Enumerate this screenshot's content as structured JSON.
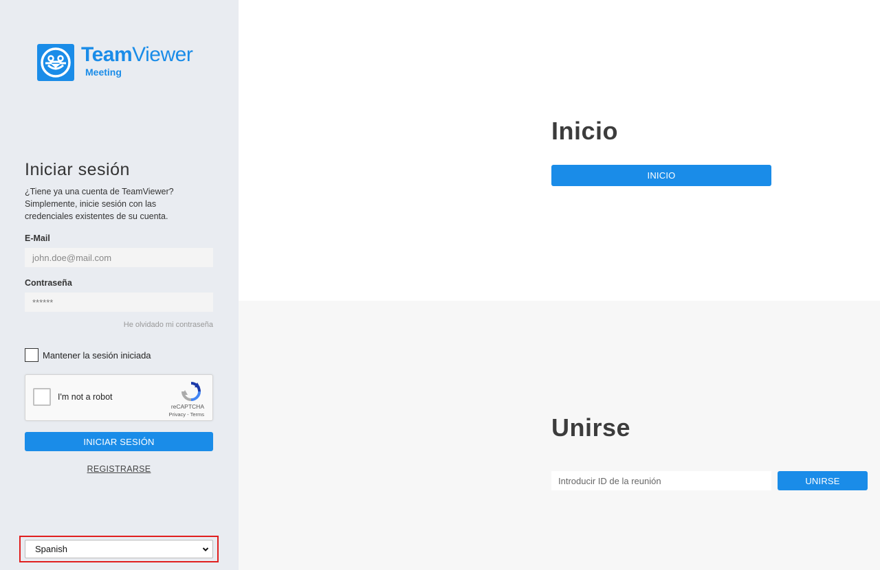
{
  "brand": {
    "name_bold": "Team",
    "name_regular": "Viewer",
    "product": "Meeting",
    "color": "#1a8ce8"
  },
  "login": {
    "title": "Iniciar sesión",
    "description": "¿Tiene ya una cuenta de TeamViewer? Simplemente, inicie sesión con las credenciales existentes de su cuenta.",
    "email_label": "E-Mail",
    "email_placeholder": "john.doe@mail.com",
    "password_label": "Contraseña",
    "password_value": "******",
    "forgot_link": "He olvidado mi contraseña",
    "keep_session_label": "Mantener la sesión iniciada",
    "submit_label": "INICIAR SESIÓN",
    "register_link": "REGISTRARSE"
  },
  "recaptcha": {
    "label": "I'm not a robot",
    "brand": "reCAPTCHA",
    "terms": "Privacy - Terms"
  },
  "language": {
    "selected": "Spanish"
  },
  "start": {
    "heading": "Inicio",
    "button_label": "INICIO"
  },
  "join": {
    "heading": "Unirse",
    "input_placeholder": "Introducir ID de la reunión",
    "button_label": "UNIRSE"
  }
}
